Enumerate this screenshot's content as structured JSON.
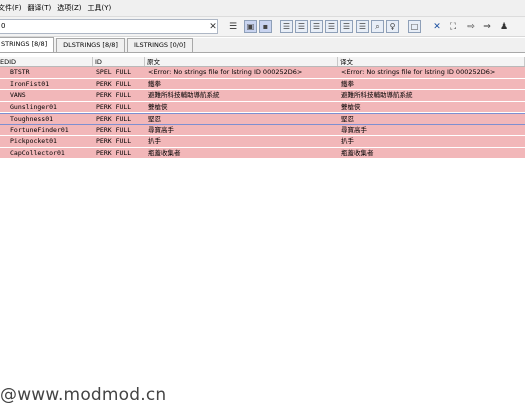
{
  "menu": [
    "文件(F)",
    "翻译(T)",
    "选项(Z)",
    "工具(Y)"
  ],
  "search": {
    "value": "0"
  },
  "toolbar": {
    "clear_icon": "✕",
    "close_icon": "✕",
    "arrow_icon": "⇒"
  },
  "tabs": [
    {
      "label": "STRINGS [8/8]",
      "active": true
    },
    {
      "label": "DLSTRINGS [8/8]",
      "active": false
    },
    {
      "label": "ILSTRINGS [0/0]",
      "active": false
    }
  ],
  "table": {
    "headers": [
      "EDID",
      "ID",
      "原文",
      "译文"
    ],
    "rows": [
      {
        "edid": "BTSTR",
        "id": "SPEL FULL",
        "source": "<Error: No strings file for lstring ID 000252D6>",
        "target": "<Error: No strings file for lstring ID 000252D6>"
      },
      {
        "edid": "IronFist01",
        "id": "PERK FULL",
        "source": "鐵拳",
        "target": "鐵拳"
      },
      {
        "edid": "VANS",
        "id": "PERK FULL",
        "source": "避難所科技輔助導航系統",
        "target": "避難所科技輔助導航系統"
      },
      {
        "edid": "Gunslinger01",
        "id": "PERK FULL",
        "source": "雙槍俠",
        "target": "雙槍俠"
      },
      {
        "edid": "Toughness01",
        "id": "PERK FULL",
        "source": "堅忍",
        "target": "堅忍"
      },
      {
        "edid": "FortuneFinder01",
        "id": "PERK FULL",
        "source": "尋寶高手",
        "target": "尋寶高手"
      },
      {
        "edid": "Pickpocket01",
        "id": "PERK FULL",
        "source": "扒手",
        "target": "扒手"
      },
      {
        "edid": "CapCollector01",
        "id": "PERK FULL",
        "source": "瓶蓋收集者",
        "target": "瓶蓋收集者"
      }
    ]
  },
  "watermark": "@www.modmod.cn"
}
